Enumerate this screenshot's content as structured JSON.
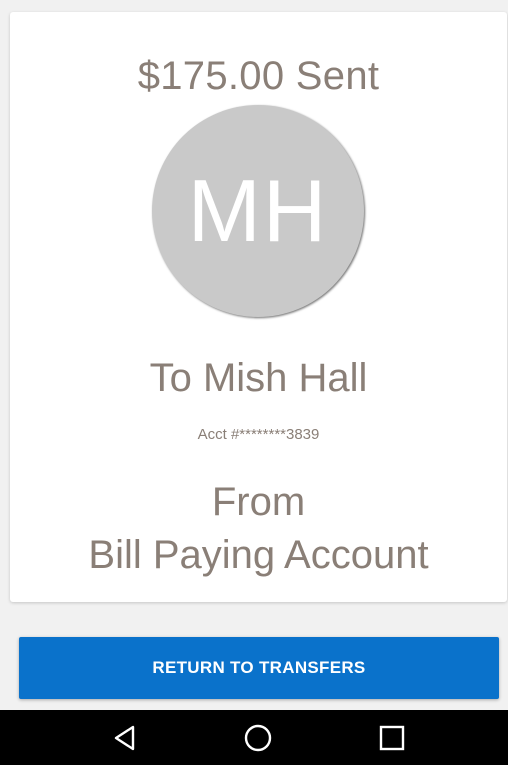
{
  "transfer": {
    "amount_text": "$175.00 Sent",
    "avatar_initials": "MH",
    "recipient_text": "To Mish Hall",
    "account_text": "Acct #********3839",
    "from_label": "From",
    "from_account": "Bill Paying Account"
  },
  "actions": {
    "return_label": "RETURN TO TRANSFERS"
  },
  "navigation": {
    "back_icon": "back-triangle-icon",
    "home_icon": "home-circle-icon",
    "recent_icon": "recent-apps-square-icon"
  },
  "colors": {
    "text": "#8a7f77",
    "avatar": "#c9c9c9",
    "primary_button": "#0a72cb",
    "background": "#f1f1f1",
    "navbar": "#000000"
  }
}
